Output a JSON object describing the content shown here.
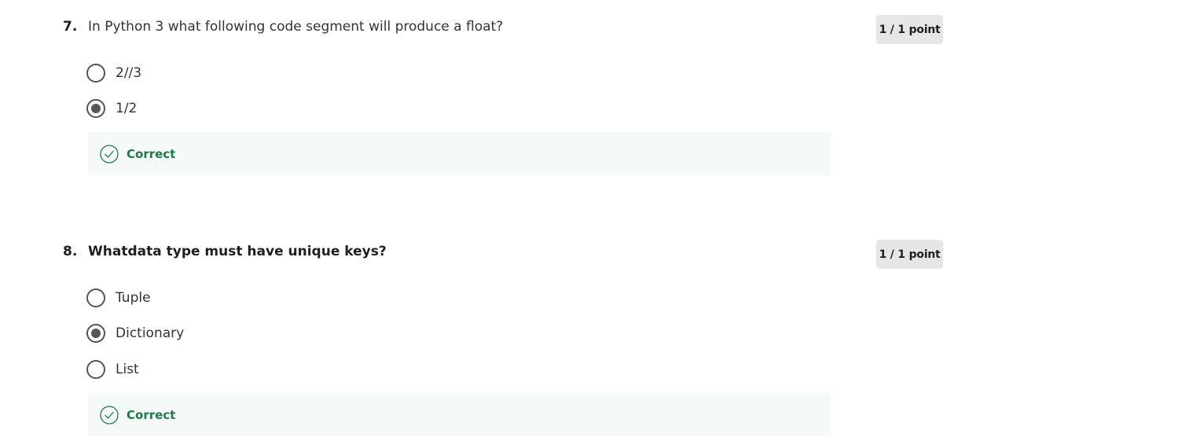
{
  "questions": [
    {
      "number": "7.",
      "prompt": "In Python 3 what following code segment will produce a float?",
      "points": "1 / 1 point",
      "options": [
        {
          "label": "2//3",
          "selected": false
        },
        {
          "label": "1/2",
          "selected": true
        }
      ],
      "feedback": "Correct"
    },
    {
      "number": "8.",
      "prompt": "Whatdata type must have unique keys?",
      "points": "1 / 1 point",
      "options": [
        {
          "label": "Tuple",
          "selected": false
        },
        {
          "label": "Dictionary",
          "selected": true
        },
        {
          "label": "List",
          "selected": false
        }
      ],
      "feedback": "Correct"
    }
  ],
  "colors": {
    "correct": "#1e7a4b",
    "feedback_bg": "#f5f9f8",
    "badge_bg": "#e6e6e6",
    "radio": "#555555"
  },
  "icons": {
    "feedback": "check-circle-icon",
    "option": "radio-button-icon"
  }
}
